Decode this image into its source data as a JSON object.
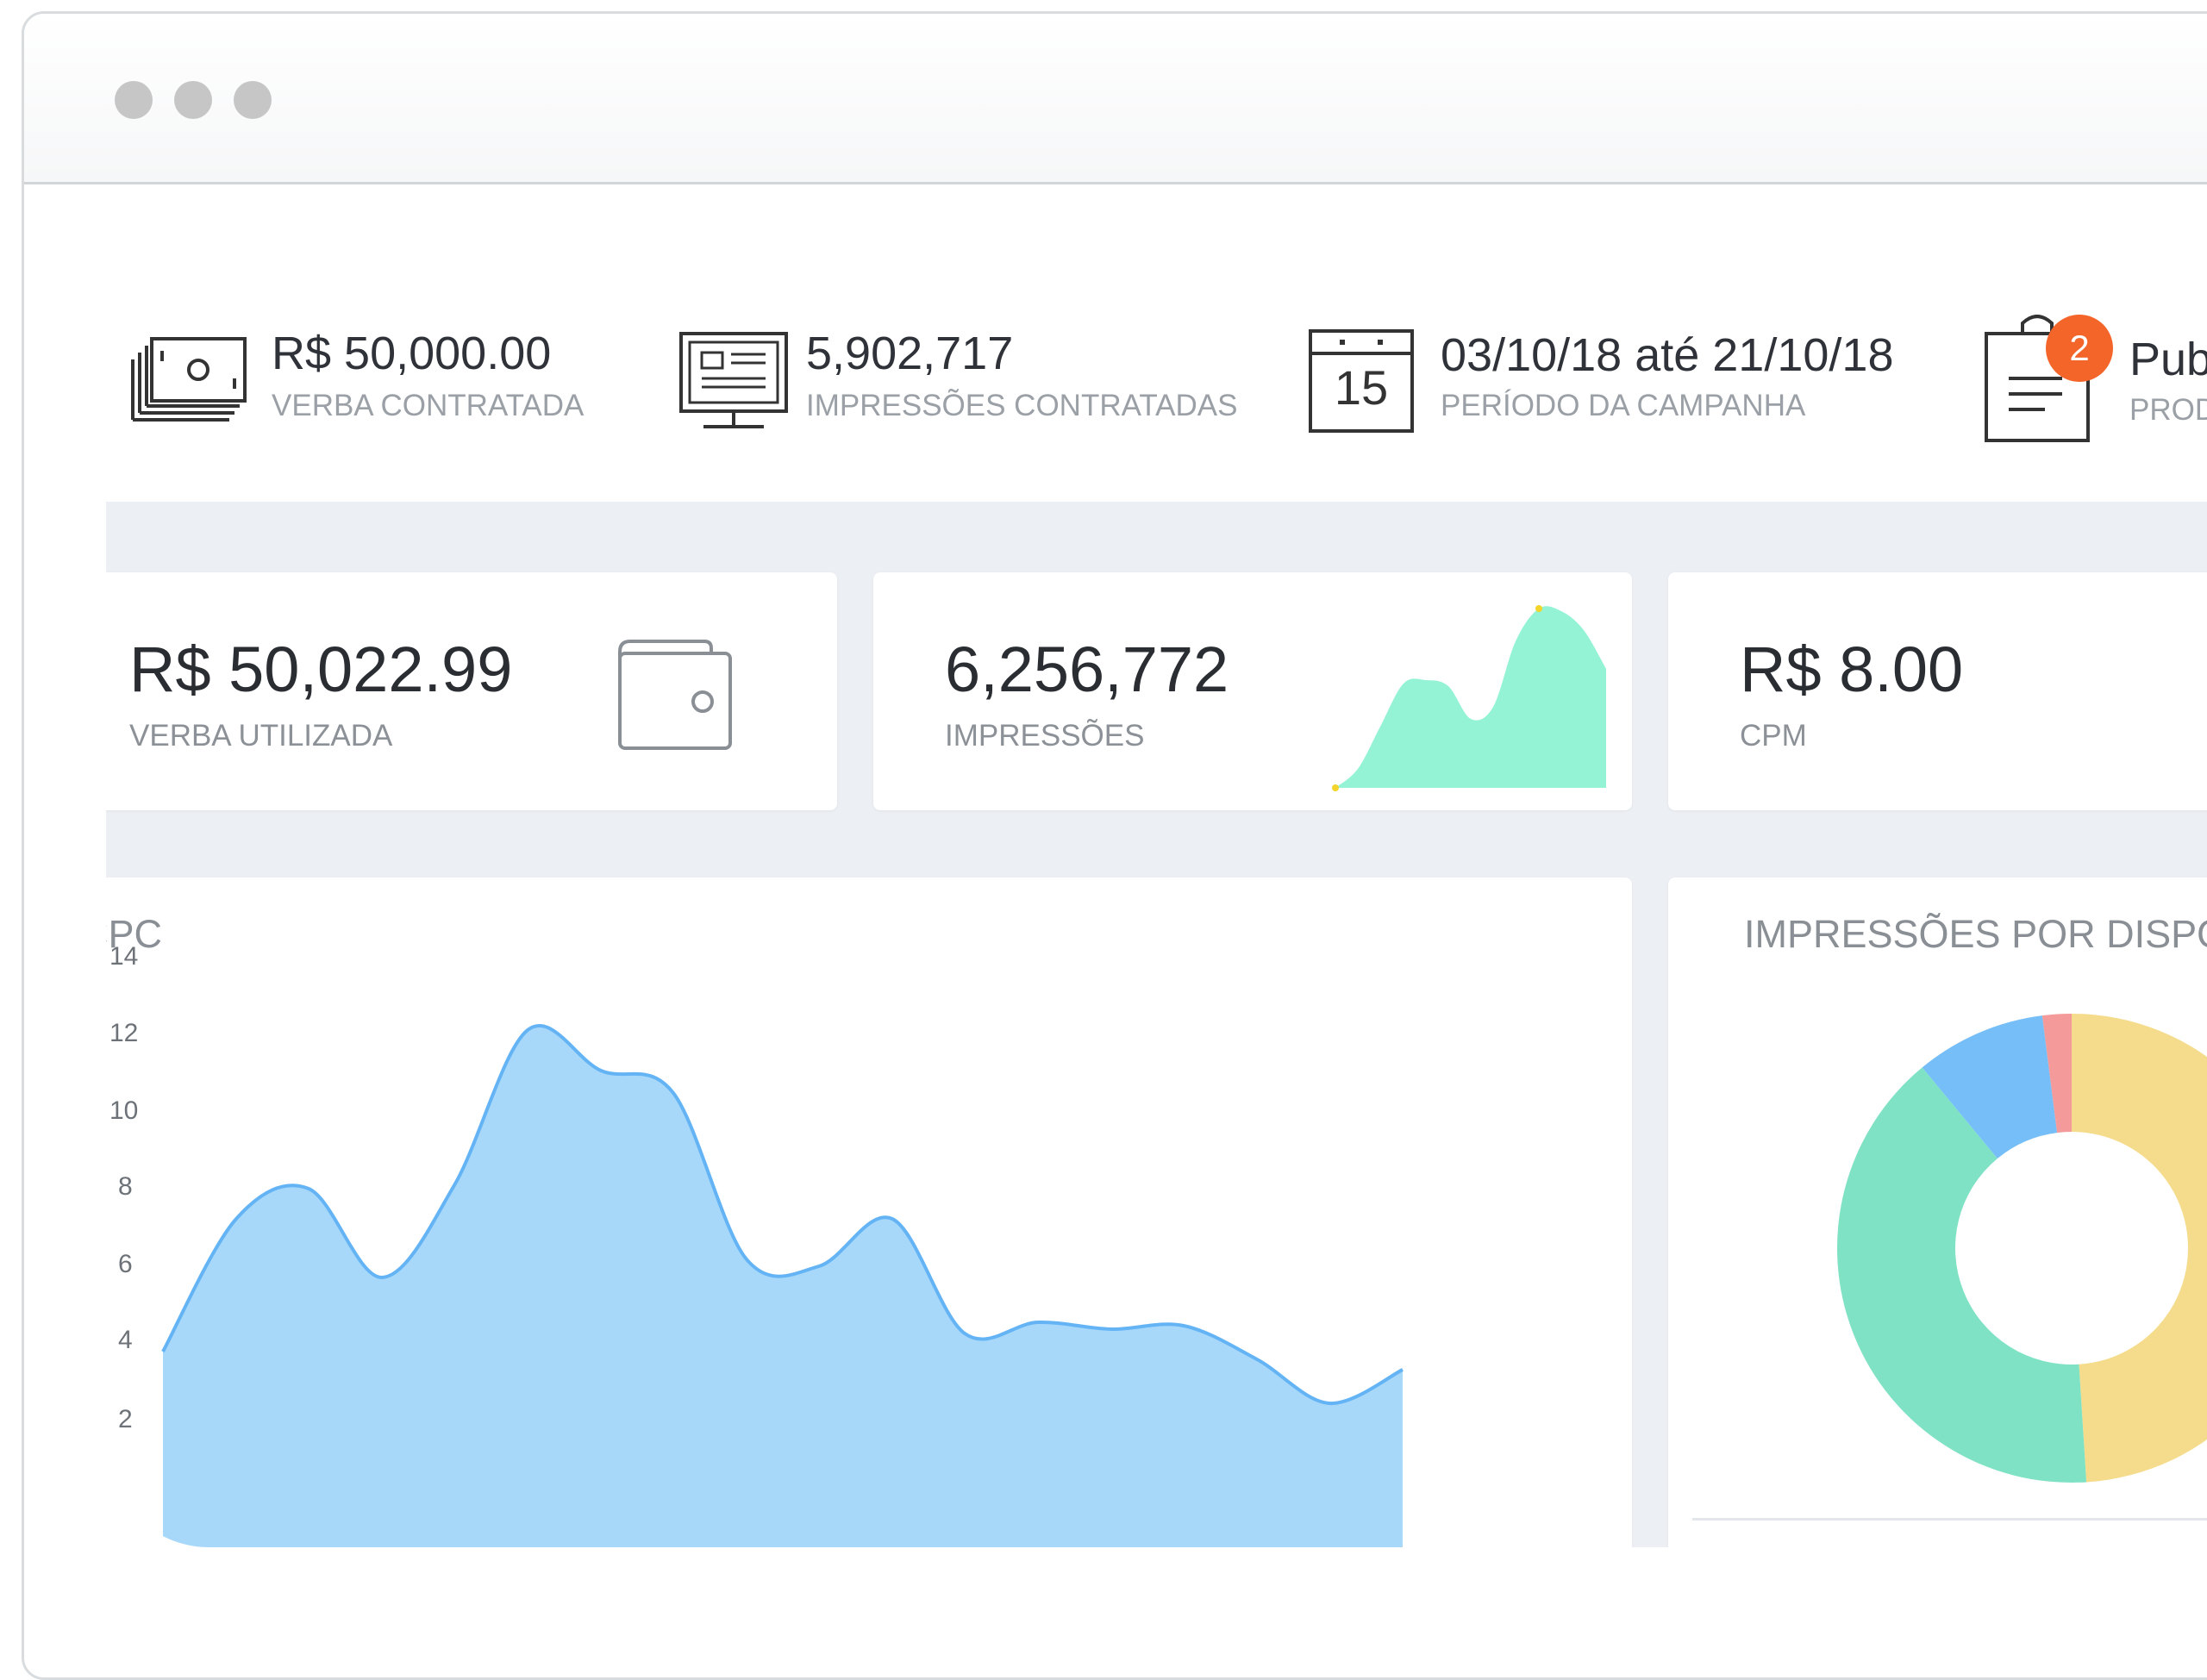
{
  "window": {
    "dots": [
      "dot",
      "dot",
      "dot"
    ]
  },
  "header_stats": [
    {
      "value": "R$ 50,000.00",
      "label": "VERBA CONTRATADA",
      "icon": "money-stack-icon"
    },
    {
      "value": "5,902,717",
      "label": "IMPRESSÕES CONTRATADAS",
      "icon": "display-monitor-icon"
    },
    {
      "value": "03/10/18 até 21/10/18",
      "label": "PERÍODO DA CAMPANHA",
      "icon": "calendar-icon",
      "icon_text": "15"
    },
    {
      "value": "Pub",
      "label": "PROD",
      "icon": "clipboard-icon",
      "badge": "2"
    }
  ],
  "kpis": [
    {
      "value": "R$ 50,022.99",
      "label": "VERBA UTILIZADA",
      "icon": "wallet-icon"
    },
    {
      "value": "6,256,772",
      "label": "IMPRESSÕES",
      "icon": "sparkline"
    },
    {
      "value": "R$ 8.00",
      "label": "CPM"
    }
  ],
  "colors": {
    "sparkline_fill": "#93f3d4",
    "sparkline_dot": "#f2d42a",
    "area_fill": "#a7d8fa",
    "area_stroke": "#64b4f5",
    "badge": "#f4652a",
    "donut_yellow": "#f5dc8c",
    "donut_green": "#7fe2c4",
    "donut_blue": "#76bef8",
    "donut_red": "#f59a9a"
  },
  "chart_data": [
    {
      "type": "area",
      "title": "CPC",
      "yticks": [
        "14",
        "12",
        "10",
        "8",
        "6",
        "4",
        "2"
      ],
      "ylim": [
        0.5,
        14.5
      ],
      "x": [
        0,
        1,
        2,
        3,
        4,
        5,
        6,
        7,
        8,
        9,
        10,
        11,
        12,
        13,
        14,
        15,
        16,
        17
      ],
      "values": [
        4.0,
        7.6,
        8.4,
        6.0,
        8.5,
        12.7,
        11.6,
        11.0,
        6.5,
        6.3,
        7.6,
        4.5,
        4.8,
        4.6,
        4.7,
        3.8,
        2.6,
        3.5
      ]
    },
    {
      "type": "pie",
      "title": "IMPRESSÕES POR DISPO",
      "values": [
        {
          "name": "yellow",
          "value": 49,
          "color": "#f5dc8c"
        },
        {
          "name": "green",
          "value": 40,
          "color": "#7fe2c4"
        },
        {
          "name": "blue",
          "value": 9,
          "color": "#76bef8"
        },
        {
          "name": "red",
          "value": 2,
          "color": "#f59a9a"
        }
      ]
    },
    {
      "type": "area",
      "title": "",
      "x": [
        0,
        1,
        2,
        3,
        4,
        5,
        6,
        7,
        8,
        9,
        10,
        11,
        12
      ],
      "values": [
        0,
        1,
        3.2,
        5.4,
        5.6,
        5.3,
        3.6,
        4.2,
        7.6,
        9.3,
        9.2,
        8.2,
        6.2
      ]
    }
  ]
}
